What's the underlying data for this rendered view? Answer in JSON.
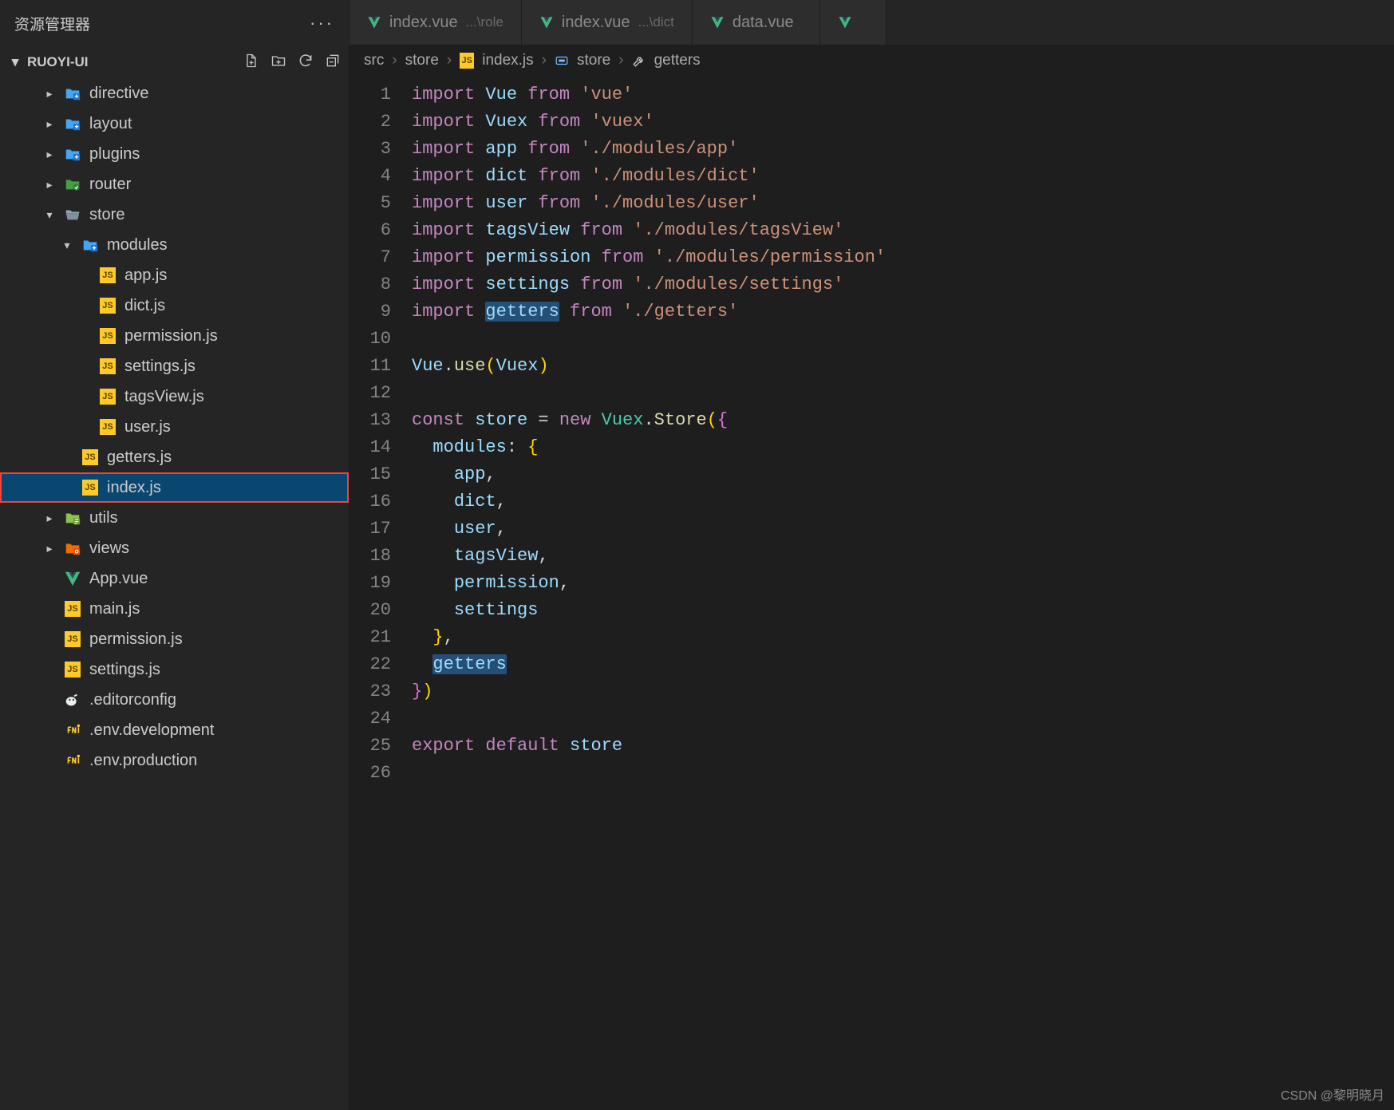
{
  "sidebar": {
    "title": "资源管理器",
    "section": "RUOYI-UI",
    "tree": [
      {
        "indent": 2,
        "kind": "folder-ext",
        "chev": "right",
        "label": "directive"
      },
      {
        "indent": 2,
        "kind": "folder-ext",
        "chev": "right",
        "label": "layout"
      },
      {
        "indent": 2,
        "kind": "folder-ext",
        "chev": "right",
        "label": "plugins"
      },
      {
        "indent": 2,
        "kind": "folder-route",
        "chev": "right",
        "label": "router"
      },
      {
        "indent": 2,
        "kind": "folder-open",
        "chev": "down",
        "label": "store"
      },
      {
        "indent": 3,
        "kind": "folder-ext",
        "chev": "down",
        "label": "modules"
      },
      {
        "indent": 4,
        "kind": "js",
        "chev": "",
        "label": "app.js"
      },
      {
        "indent": 4,
        "kind": "js",
        "chev": "",
        "label": "dict.js"
      },
      {
        "indent": 4,
        "kind": "js",
        "chev": "",
        "label": "permission.js"
      },
      {
        "indent": 4,
        "kind": "js",
        "chev": "",
        "label": "settings.js"
      },
      {
        "indent": 4,
        "kind": "js",
        "chev": "",
        "label": "tagsView.js"
      },
      {
        "indent": 4,
        "kind": "js",
        "chev": "",
        "label": "user.js"
      },
      {
        "indent": 3,
        "kind": "js",
        "chev": "",
        "label": "getters.js"
      },
      {
        "indent": 3,
        "kind": "js",
        "chev": "",
        "label": "index.js",
        "selected": true,
        "highlight": true
      },
      {
        "indent": 2,
        "kind": "folder-utils",
        "chev": "right",
        "label": "utils"
      },
      {
        "indent": 2,
        "kind": "folder-views",
        "chev": "right",
        "label": "views"
      },
      {
        "indent": 2,
        "kind": "vue",
        "chev": "",
        "label": "App.vue"
      },
      {
        "indent": 2,
        "kind": "js",
        "chev": "",
        "label": "main.js"
      },
      {
        "indent": 2,
        "kind": "js",
        "chev": "",
        "label": "permission.js"
      },
      {
        "indent": 2,
        "kind": "js",
        "chev": "",
        "label": "settings.js"
      },
      {
        "indent": 2,
        "kind": "editorconfig",
        "chev": "",
        "label": ".editorconfig"
      },
      {
        "indent": 2,
        "kind": "env",
        "chev": "",
        "label": ".env.development"
      },
      {
        "indent": 2,
        "kind": "env",
        "chev": "",
        "label": ".env.production"
      }
    ]
  },
  "tabs": [
    {
      "icon": "vue",
      "label": "index.vue",
      "path": "...\\role"
    },
    {
      "icon": "vue",
      "label": "index.vue",
      "path": "...\\dict"
    },
    {
      "icon": "vue",
      "label": "data.vue",
      "path": ""
    },
    {
      "icon": "vue",
      "label": "",
      "path": ""
    }
  ],
  "breadcrumb": [
    {
      "kind": "text",
      "label": "src"
    },
    {
      "kind": "text",
      "label": "store"
    },
    {
      "kind": "js",
      "label": "index.js"
    },
    {
      "kind": "const",
      "label": "store"
    },
    {
      "kind": "wrench",
      "label": "getters"
    }
  ],
  "code": {
    "lines": [
      [
        {
          "t": "kw",
          "v": "import"
        },
        {
          "v": " "
        },
        {
          "t": "var",
          "v": "Vue"
        },
        {
          "v": " "
        },
        {
          "t": "kw",
          "v": "from"
        },
        {
          "v": " "
        },
        {
          "t": "str",
          "v": "'vue'"
        }
      ],
      [
        {
          "t": "kw",
          "v": "import"
        },
        {
          "v": " "
        },
        {
          "t": "var",
          "v": "Vuex"
        },
        {
          "v": " "
        },
        {
          "t": "kw",
          "v": "from"
        },
        {
          "v": " "
        },
        {
          "t": "str",
          "v": "'vuex'"
        }
      ],
      [
        {
          "t": "kw",
          "v": "import"
        },
        {
          "v": " "
        },
        {
          "t": "var",
          "v": "app"
        },
        {
          "v": " "
        },
        {
          "t": "kw",
          "v": "from"
        },
        {
          "v": " "
        },
        {
          "t": "str",
          "v": "'./modules/app'"
        }
      ],
      [
        {
          "t": "kw",
          "v": "import"
        },
        {
          "v": " "
        },
        {
          "t": "var",
          "v": "dict"
        },
        {
          "v": " "
        },
        {
          "t": "kw",
          "v": "from"
        },
        {
          "v": " "
        },
        {
          "t": "str",
          "v": "'./modules/dict'"
        }
      ],
      [
        {
          "t": "kw",
          "v": "import"
        },
        {
          "v": " "
        },
        {
          "t": "var",
          "v": "user"
        },
        {
          "v": " "
        },
        {
          "t": "kw",
          "v": "from"
        },
        {
          "v": " "
        },
        {
          "t": "str",
          "v": "'./modules/user'"
        }
      ],
      [
        {
          "t": "kw",
          "v": "import"
        },
        {
          "v": " "
        },
        {
          "t": "var",
          "v": "tagsView"
        },
        {
          "v": " "
        },
        {
          "t": "kw",
          "v": "from"
        },
        {
          "v": " "
        },
        {
          "t": "str",
          "v": "'./modules/tagsView'"
        }
      ],
      [
        {
          "t": "kw",
          "v": "import"
        },
        {
          "v": " "
        },
        {
          "t": "var",
          "v": "permission"
        },
        {
          "v": " "
        },
        {
          "t": "kw",
          "v": "from"
        },
        {
          "v": " "
        },
        {
          "t": "str",
          "v": "'./modules/permission'"
        }
      ],
      [
        {
          "t": "kw",
          "v": "import"
        },
        {
          "v": " "
        },
        {
          "t": "var",
          "v": "settings"
        },
        {
          "v": " "
        },
        {
          "t": "kw",
          "v": "from"
        },
        {
          "v": " "
        },
        {
          "t": "str",
          "v": "'./modules/settings'"
        }
      ],
      [
        {
          "t": "kw",
          "v": "import"
        },
        {
          "v": " "
        },
        {
          "t": "var",
          "hl": true,
          "v": "getters"
        },
        {
          "v": " "
        },
        {
          "t": "kw",
          "v": "from"
        },
        {
          "v": " "
        },
        {
          "t": "str",
          "v": "'./getters'"
        }
      ],
      [],
      [
        {
          "t": "var",
          "v": "Vue"
        },
        {
          "v": "."
        },
        {
          "t": "fn",
          "v": "use"
        },
        {
          "t": "br1",
          "v": "("
        },
        {
          "t": "var",
          "v": "Vuex"
        },
        {
          "t": "br1",
          "v": ")"
        }
      ],
      [],
      [
        {
          "t": "kw",
          "v": "const"
        },
        {
          "v": " "
        },
        {
          "t": "var",
          "v": "store"
        },
        {
          "v": " = "
        },
        {
          "t": "kw",
          "v": "new"
        },
        {
          "v": " "
        },
        {
          "t": "cls",
          "v": "Vuex"
        },
        {
          "v": "."
        },
        {
          "t": "fn",
          "v": "Store"
        },
        {
          "t": "br1",
          "v": "("
        },
        {
          "t": "br2",
          "v": "{"
        }
      ],
      [
        {
          "v": "  "
        },
        {
          "t": "var",
          "v": "modules"
        },
        {
          "v": ": "
        },
        {
          "t": "br1",
          "v": "{"
        }
      ],
      [
        {
          "v": "    "
        },
        {
          "t": "var",
          "v": "app"
        },
        {
          "v": ","
        }
      ],
      [
        {
          "v": "    "
        },
        {
          "t": "var",
          "v": "dict"
        },
        {
          "v": ","
        }
      ],
      [
        {
          "v": "    "
        },
        {
          "t": "var",
          "v": "user"
        },
        {
          "v": ","
        }
      ],
      [
        {
          "v": "    "
        },
        {
          "t": "var",
          "v": "tagsView"
        },
        {
          "v": ","
        }
      ],
      [
        {
          "v": "    "
        },
        {
          "t": "var",
          "v": "permission"
        },
        {
          "v": ","
        }
      ],
      [
        {
          "v": "    "
        },
        {
          "t": "var",
          "v": "settings"
        }
      ],
      [
        {
          "v": "  "
        },
        {
          "t": "br1",
          "v": "}"
        },
        {
          "v": ","
        }
      ],
      [
        {
          "v": "  "
        },
        {
          "t": "var",
          "hl": true,
          "v": "getters"
        }
      ],
      [
        {
          "t": "br2",
          "v": "}"
        },
        {
          "t": "br1",
          "v": ")"
        }
      ],
      [],
      [
        {
          "t": "kw",
          "v": "export"
        },
        {
          "v": " "
        },
        {
          "t": "kw",
          "v": "default"
        },
        {
          "v": " "
        },
        {
          "t": "var",
          "v": "store"
        }
      ],
      []
    ]
  },
  "watermark": "CSDN @黎明晓月"
}
